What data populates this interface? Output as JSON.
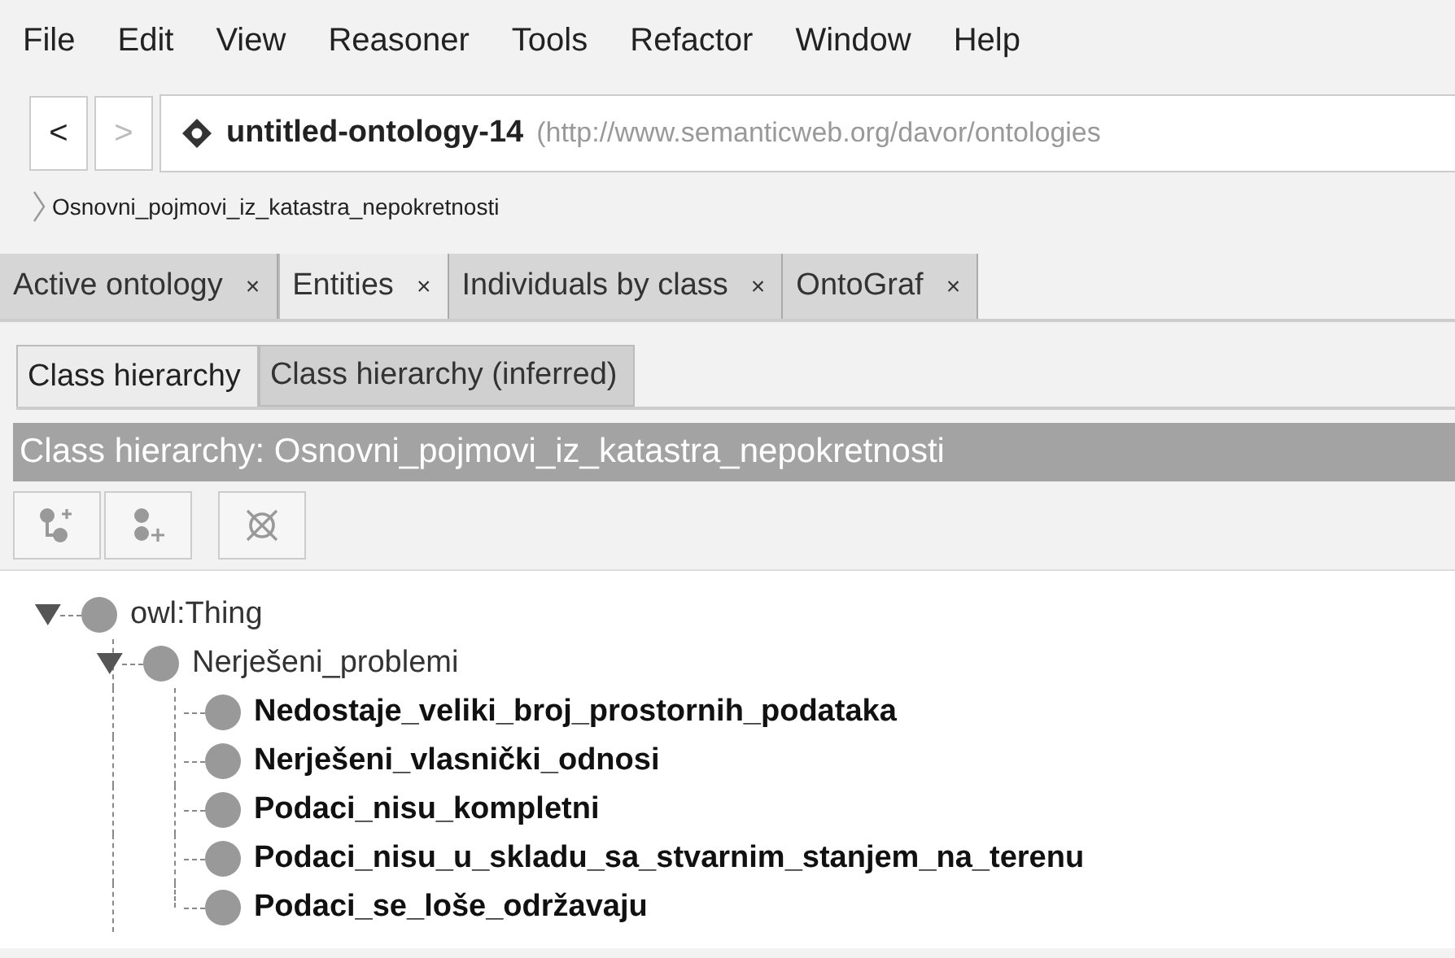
{
  "menu": [
    "File",
    "Edit",
    "View",
    "Reasoner",
    "Tools",
    "Refactor",
    "Window",
    "Help"
  ],
  "nav": {
    "back": "<",
    "forward": ">",
    "back_disabled": false,
    "forward_disabled": true,
    "ontology": "untitled-ontology-14",
    "iri": "(http://www.semanticweb.org/davor/ontologies"
  },
  "breadcrumb": "Osnovni_pojmovi_iz_katastra_nepokretnosti",
  "tabs": [
    {
      "label": "Active ontology",
      "close": "×",
      "selected": false
    },
    {
      "label": "Entities",
      "close": "×",
      "selected": true
    },
    {
      "label": "Individuals by class",
      "close": "×",
      "selected": false
    },
    {
      "label": "OntoGraf",
      "close": "×",
      "selected": false
    }
  ],
  "subtabs": [
    {
      "label": "Class hierarchy",
      "selected": true
    },
    {
      "label": "Class hierarchy (inferred)",
      "selected": false
    }
  ],
  "panel_title": "Class hierarchy: Osnovni_pojmovi_iz_katastra_nepokretnosti",
  "tree": [
    {
      "label": "owl:Thing",
      "bold": false,
      "expanded": true,
      "children": [
        {
          "label": "Nerješeni_problemi",
          "bold": false,
          "expanded": true,
          "children": [
            {
              "label": "Nedostaje_veliki_broj_prostornih_podataka",
              "bold": true
            },
            {
              "label": "Nerješeni_vlasnički_odnosi",
              "bold": true
            },
            {
              "label": "Podaci_nisu_kompletni",
              "bold": true
            },
            {
              "label": "Podaci_nisu_u_skladu_sa_stvarnim_stanjem_na_terenu",
              "bold": true
            },
            {
              "label": "Podaci_se_loše_održavaju",
              "bold": true
            }
          ]
        }
      ]
    }
  ]
}
